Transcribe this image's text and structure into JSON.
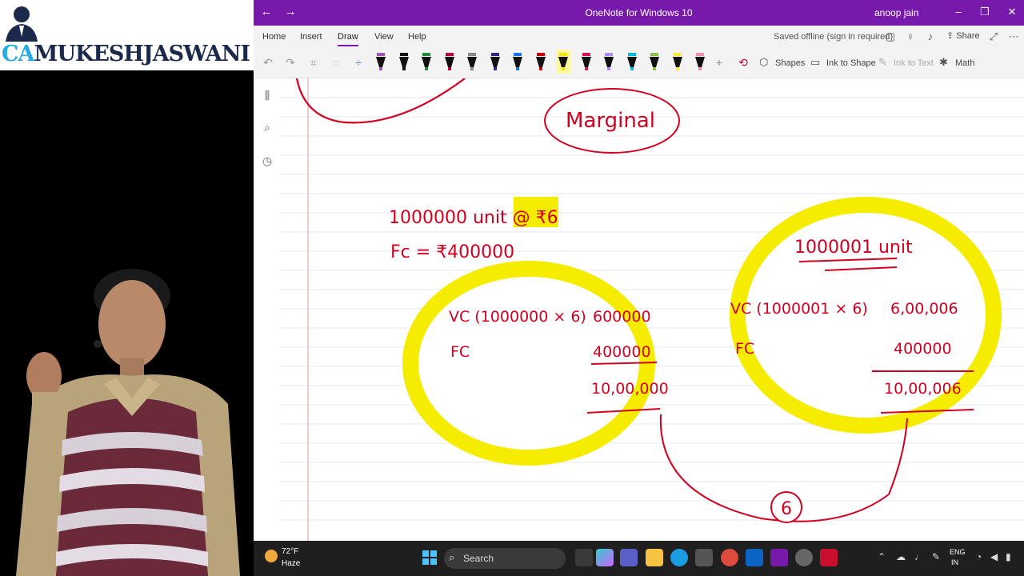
{
  "brand": {
    "ca": "CA",
    "name": "MUKESHJASWANI"
  },
  "window": {
    "title": "OneNote for Windows 10",
    "user": "anoop jain"
  },
  "menu": {
    "tabs": [
      "Home",
      "Insert",
      "Draw",
      "View",
      "Help"
    ],
    "active_tab": "Draw",
    "status": "Saved offline (sign in required)",
    "share_label": "Share"
  },
  "toolbar": {
    "shapes_label": "Shapes",
    "ink_to_shape_label": "Ink to Shape",
    "ink_to_text_label": "Ink to Text",
    "math_label": "Math",
    "pens": [
      {
        "color": "#9b59b6",
        "icon": "highlighter-pen-icon"
      },
      {
        "color": "#111111",
        "icon": "pen-icon"
      },
      {
        "color": "#1e8e3e",
        "icon": "pen-icon"
      },
      {
        "color": "#c0003a",
        "icon": "pen-icon"
      },
      {
        "color": "#888888",
        "icon": "pencil-icon"
      },
      {
        "color": "#2a2a88",
        "icon": "pen-icon"
      },
      {
        "color": "#1a73e8",
        "icon": "pen-icon"
      },
      {
        "color": "#d00000",
        "icon": "pen-icon"
      },
      {
        "color": "#f7e600",
        "icon": "highlighter-icon"
      },
      {
        "color": "#d4145a",
        "icon": "pen-icon"
      },
      {
        "color": "#b388ff",
        "icon": "highlighter-icon"
      },
      {
        "color": "#00bcd4",
        "icon": "highlighter-icon"
      },
      {
        "color": "#8bc34a",
        "icon": "highlighter-icon"
      },
      {
        "color": "#ffeb3b",
        "icon": "highlighter-icon"
      },
      {
        "color": "#f48fb1",
        "icon": "highlighter-icon"
      }
    ]
  },
  "notes": {
    "marginal": "Marginal",
    "units_line": "1000000 unit @ ₹6",
    "fc_line": "Fc = ₹400000",
    "left_block": {
      "vc_label": "VC (1000000 × 6)",
      "vc_value": "600000",
      "fc_label": "FC",
      "fc_value": "400000",
      "total": "10,00,000"
    },
    "right_block": {
      "heading": "1000001 unit",
      "vc_label": "VC (1000001 × 6)",
      "vc_value": "6,00,006",
      "fc_label": "FC",
      "fc_value": "400000",
      "total": "10,00,006"
    },
    "difference": "6"
  },
  "taskbar": {
    "temperature": "72°F",
    "condition": "Haze",
    "search_placeholder": "Search",
    "lang_top": "ENG",
    "lang_bottom": "IN"
  },
  "colors": {
    "accent": "#7719aa",
    "ink_red": "#d4001f",
    "highlight": "#f5ec00"
  }
}
